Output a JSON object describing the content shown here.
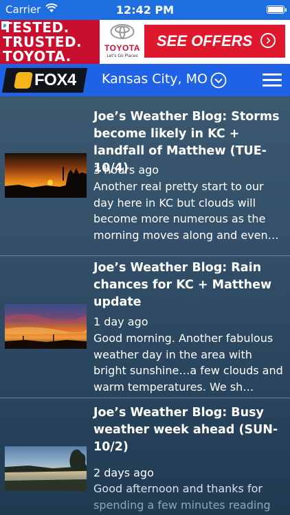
{
  "status_bar": {
    "carrier": "Carrier",
    "time": "12:42 PM",
    "wifi_icon": "wifi-icon",
    "battery_icon": "battery-full-icon"
  },
  "ad": {
    "left_lines": [
      "TESTED.",
      "TRUSTED.",
      "TOYOTA."
    ],
    "brand_name": "TOYOTA",
    "brand_tagline": "Let's Go Places",
    "cta": "SEE OFFERS",
    "colors": {
      "brand_red": "#c8102e",
      "cta_red": "#e0182d"
    }
  },
  "nav": {
    "logo_text": "FOX4",
    "location": "Kansas City, MO",
    "dropdown_icon": "chevron-down-circle-icon",
    "menu_icon": "hamburger-menu-icon",
    "colors": {
      "bar": "#1f62e6",
      "logo_badge": "#f4b41a"
    }
  },
  "articles": [
    {
      "title": "Joe’s Weather Blog: Storms become likely in KC + landfall of Matthew (TUE-10/4)",
      "time": "3 hours ago",
      "snippet": "Another real pretty start to our day here in KC but clouds will become more numerous as the morning moves along and even…"
    },
    {
      "title": "Joe’s Weather Blog: Rain chances for KC + Matthew update",
      "time": "1 day ago",
      "snippet": "Good morning. Another fabulous weather day in the area with bright sunshine…a few clouds and warm temperatures. We sh…"
    },
    {
      "title": "Joe’s Weather Blog: Busy weather week ahead (SUN-10/2)",
      "time": "2 days ago",
      "snippet_line1": "Good afternoon and thanks for",
      "snippet_line2": "spending a few minutes reading"
    }
  ]
}
